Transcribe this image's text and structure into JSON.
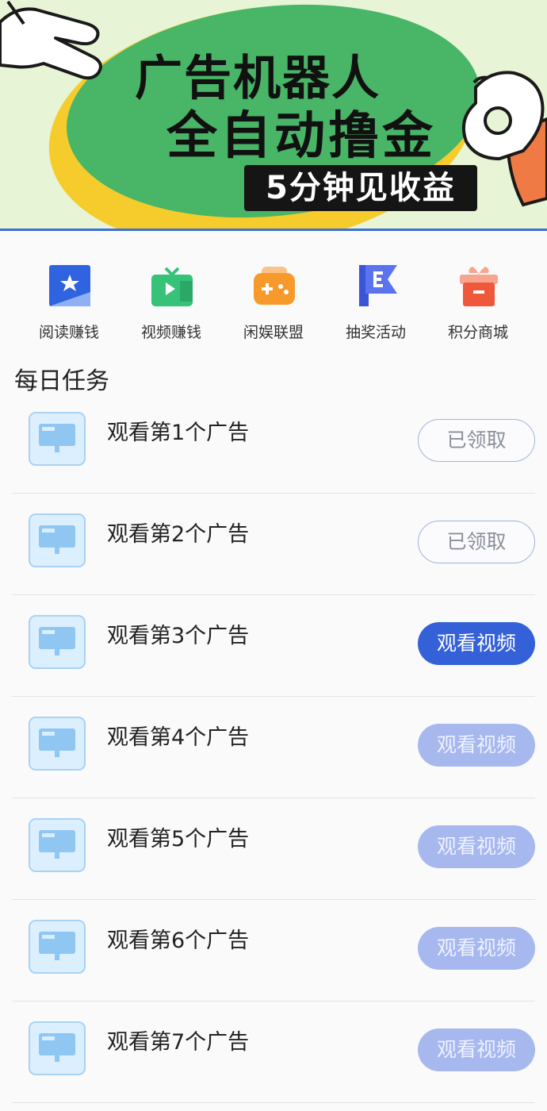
{
  "banner": {
    "title_line1": "广告机器人",
    "title_line2": "全自动撸金",
    "badge": "5分钟见收益",
    "colors": {
      "green": "#48b567",
      "yellow": "#f6cc2d",
      "bg": "#e7f4d6",
      "sleeve": "#ef7a43"
    }
  },
  "nav": [
    {
      "label": "阅读赚钱",
      "icon": "book-star-icon",
      "color": "#2f63e0"
    },
    {
      "label": "视频赚钱",
      "icon": "tv-play-icon",
      "color": "#37c27a"
    },
    {
      "label": "闲娱联盟",
      "icon": "gamepad-icon",
      "color": "#f79a2b"
    },
    {
      "label": "抽奖活动",
      "icon": "flag-icon",
      "color": "#3b55d8"
    },
    {
      "label": "积分商城",
      "icon": "gift-box-icon",
      "color": "#f0583b"
    }
  ],
  "section_title": "每日任务",
  "tasks": [
    {
      "label": "观看第1个广告",
      "button": "已领取",
      "state": "claimed"
    },
    {
      "label": "观看第2个广告",
      "button": "已领取",
      "state": "claimed"
    },
    {
      "label": "观看第3个广告",
      "button": "观看视频",
      "state": "active"
    },
    {
      "label": "观看第4个广告",
      "button": "观看视频",
      "state": "disabled"
    },
    {
      "label": "观看第5个广告",
      "button": "观看视频",
      "state": "disabled"
    },
    {
      "label": "观看第6个广告",
      "button": "观看视频",
      "state": "disabled"
    },
    {
      "label": "观看第7个广告",
      "button": "观看视频",
      "state": "disabled"
    }
  ]
}
